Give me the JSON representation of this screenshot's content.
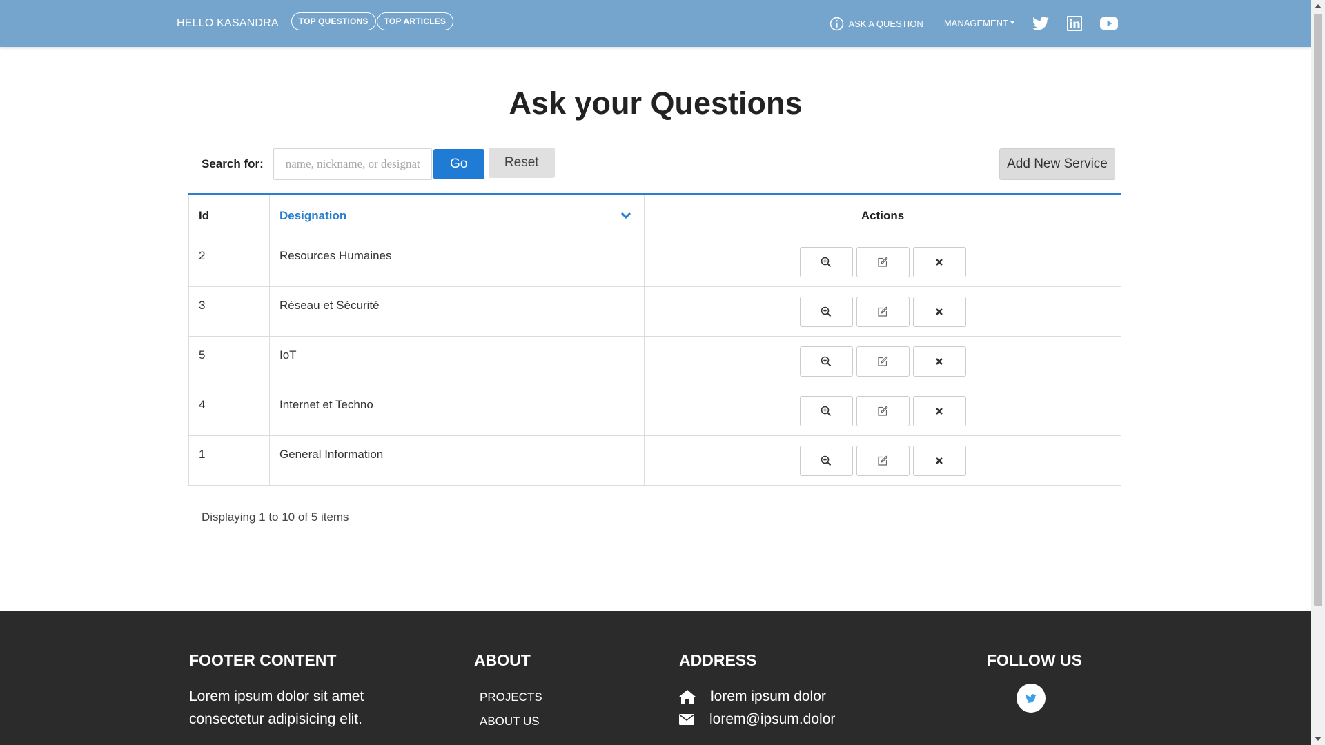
{
  "header": {
    "greeting": "HELLO KASANDRA",
    "pills": [
      "TOP QUESTIONS",
      "TOP ARTICLES"
    ],
    "ask_label": "ASK A QUESTION",
    "management_label": "MANAGEMENT",
    "social_icons": [
      "twitter-icon",
      "linkedin-icon",
      "youtube-icon"
    ],
    "bg_color": "#75a4cc"
  },
  "main": {
    "title": "Ask your Questions",
    "search": {
      "label": "Search for:",
      "placeholder": "name, nickname, or designation",
      "value": "",
      "go_label": "Go",
      "reset_label": "Reset"
    },
    "add_button_label": "Add New Service",
    "table": {
      "columns": [
        "Id",
        "Designation",
        "Actions"
      ],
      "sorted_column": "Designation",
      "rows": [
        {
          "id": "2",
          "designation": "Resources Humaines"
        },
        {
          "id": "3",
          "designation": "Réseau et Sécurité"
        },
        {
          "id": "5",
          "designation": "IoT"
        },
        {
          "id": "4",
          "designation": "Internet et Techno"
        },
        {
          "id": "1",
          "designation": "General Information"
        }
      ],
      "row_actions": [
        "view-icon",
        "edit-icon",
        "delete-icon"
      ]
    },
    "pager_info": "Displaying 1 to 10 of 5 items",
    "accent_color": "#1f7bd4"
  },
  "footer": {
    "content_heading": "FOOTER CONTENT",
    "content_text_1": "Lorem ipsum dolor sit amet",
    "content_text_2": "consectetur adipisicing elit.",
    "about_heading": "ABOUT",
    "about_links": [
      "PROJECTS",
      "ABOUT US"
    ],
    "address_heading": "ADDRESS",
    "address_street": "lorem ipsum dolor",
    "address_email": "lorem@ipsum.dolor",
    "follow_heading": "FOLLOW US",
    "bg_color": "#2b2b2b"
  }
}
